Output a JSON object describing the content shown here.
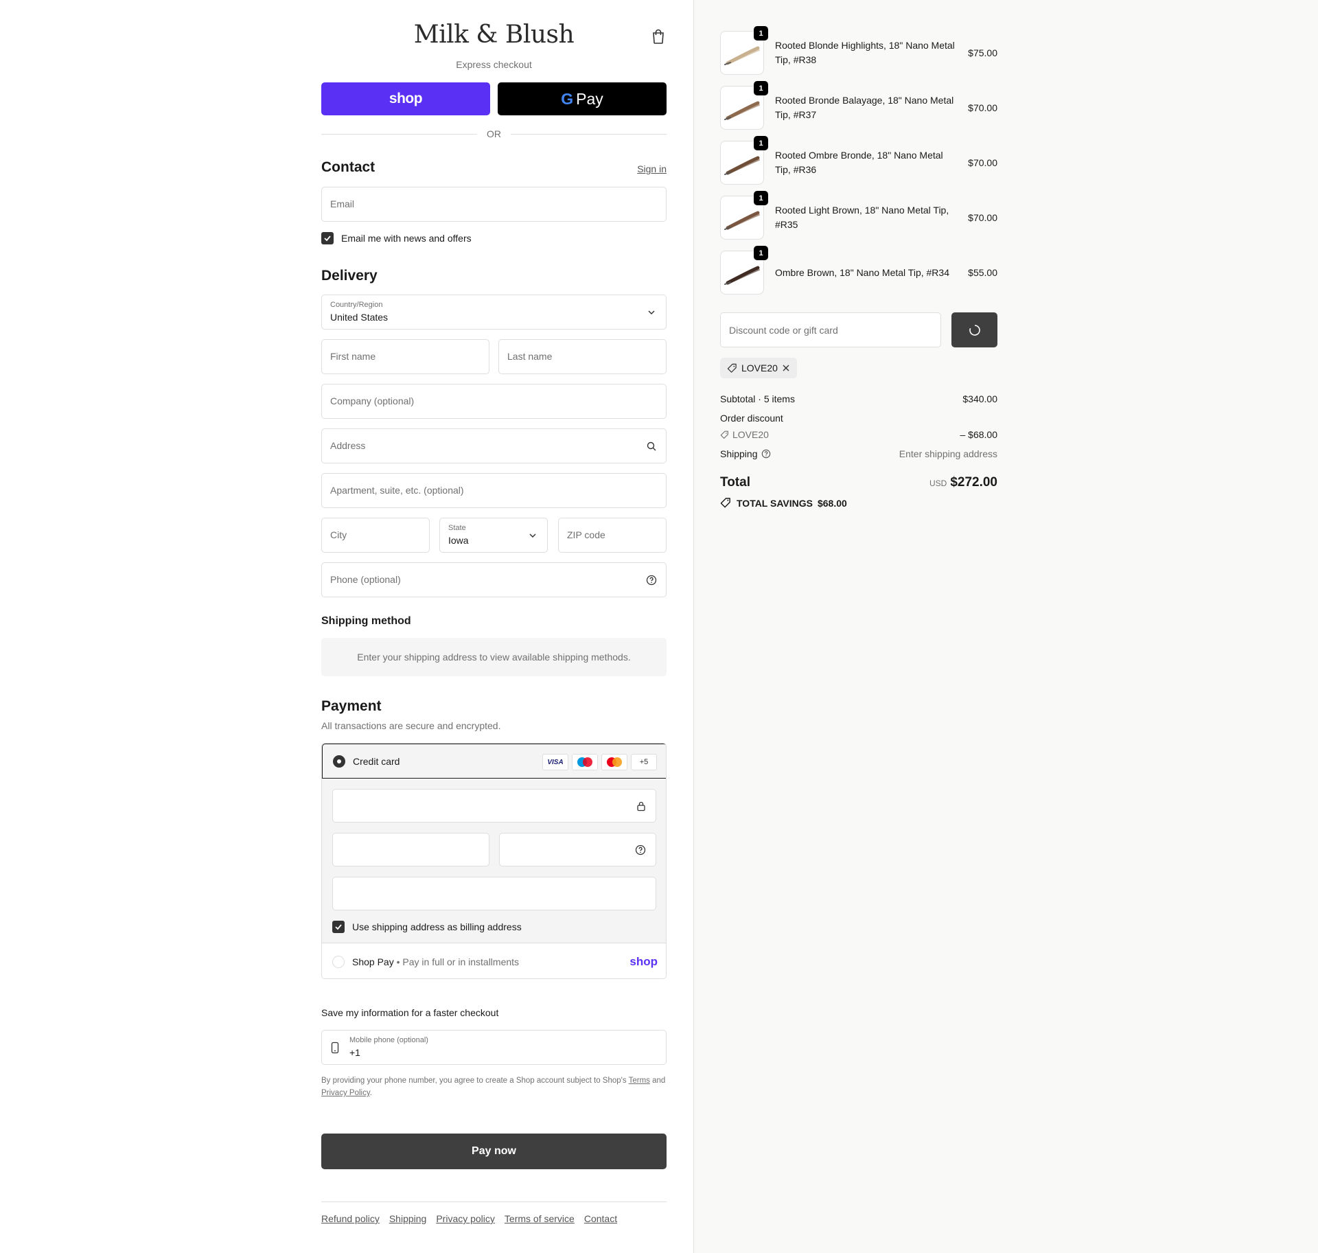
{
  "header": {
    "brand": "Milk & Blush",
    "express_label": "Express checkout",
    "shop_pay_label": "shop",
    "gpay_label": "Pay",
    "gpay_g": "G",
    "or_label": "OR"
  },
  "contact": {
    "title": "Contact",
    "sign_in": "Sign in",
    "email_placeholder": "Email",
    "news_label": "Email me with news and offers",
    "news_checked": true
  },
  "delivery": {
    "title": "Delivery",
    "country_label": "Country/Region",
    "country_value": "United States",
    "first_name_placeholder": "First name",
    "last_name_placeholder": "Last name",
    "company_placeholder": "Company (optional)",
    "address_placeholder": "Address",
    "apartment_placeholder": "Apartment, suite, etc. (optional)",
    "city_placeholder": "City",
    "state_label": "State",
    "state_value": "Iowa",
    "zip_placeholder": "ZIP code",
    "phone_placeholder": "Phone (optional)"
  },
  "shipping_method": {
    "title": "Shipping method",
    "notice": "Enter your shipping address to view available shipping methods."
  },
  "payment": {
    "title": "Payment",
    "subtitle": "All transactions are secure and encrypted.",
    "credit_card_label": "Credit card",
    "card_logos": [
      "VISA",
      "maestro",
      "mastercard",
      "+5"
    ],
    "billing_same_label": "Use shipping address as billing address",
    "shop_pay_label": "Shop Pay",
    "shop_pay_sub": "Pay in full or in installments",
    "shop_pay_logo": "shop"
  },
  "save_info": {
    "title": "Save my information for a faster checkout",
    "mobile_label": "Mobile phone (optional)",
    "mobile_value": "+1",
    "legal_prefix": "By providing your phone number, you agree to create a Shop account subject to Shop's ",
    "terms_link": "Terms",
    "legal_and": " and ",
    "privacy_link": "Privacy Policy",
    "legal_suffix": "."
  },
  "pay_now_label": "Pay now",
  "footer_links": [
    "Refund policy",
    "Shipping",
    "Privacy policy",
    "Terms of service",
    "Contact"
  ],
  "order": {
    "items": [
      {
        "name": "Rooted Blonde Highlights, 18\" Nano Metal Tip, #R38",
        "price": "$75.00",
        "qty": "1",
        "color": "#c9b08e"
      },
      {
        "name": "Rooted Bronde Balayage, 18\" Nano Metal Tip, #R37",
        "price": "$70.00",
        "qty": "1",
        "color": "#8d6a4d"
      },
      {
        "name": "Rooted Ombre Bronde, 18\" Nano Metal Tip, #R36",
        "price": "$70.00",
        "qty": "1",
        "color": "#6e4e36"
      },
      {
        "name": "Rooted Light Brown, 18\" Nano Metal Tip, #R35",
        "price": "$70.00",
        "qty": "1",
        "color": "#7a5640"
      },
      {
        "name": "Ombre Brown, 18\" Nano Metal Tip, #R34",
        "price": "$55.00",
        "qty": "1",
        "color": "#3f2b22"
      }
    ],
    "discount_placeholder": "Discount code or gift card",
    "applied_code": "LOVE20",
    "subtotal_label": "Subtotal · 5 items",
    "subtotal_value": "$340.00",
    "order_discount_label": "Order discount",
    "discount_code": "LOVE20",
    "discount_value": "– $68.00",
    "shipping_label": "Shipping",
    "shipping_value": "Enter shipping address",
    "total_label": "Total",
    "currency": "USD",
    "total_value": "$272.00",
    "savings_label": "TOTAL SAVINGS",
    "savings_value": "$68.00"
  },
  "colors": {
    "shop_purple": "#5a31f4",
    "dark_button": "#3f3f3f",
    "sidebar_bg": "#f9f9f8"
  }
}
